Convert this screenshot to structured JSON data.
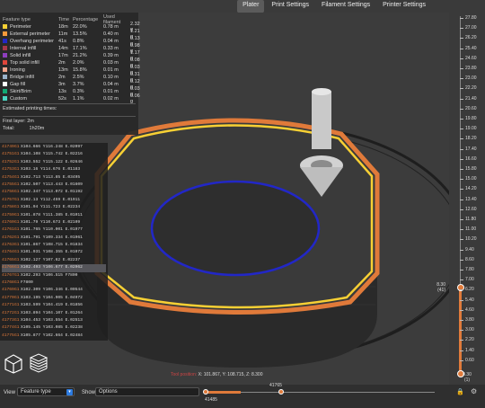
{
  "tabs": [
    {
      "label": "Plater",
      "active": true
    },
    {
      "label": "Print Settings",
      "active": false
    },
    {
      "label": "Filament Settings",
      "active": false
    },
    {
      "label": "Printer Settings",
      "active": false
    }
  ],
  "legend": {
    "headers": {
      "type": "Feature type",
      "time": "Time",
      "pct": "Percentage",
      "used": "Used filament"
    },
    "rows": [
      {
        "color": "#f7d034",
        "name": "Perimeter",
        "time": "18m",
        "pct": "22.0%",
        "m": "0.78 m",
        "g": "2.32 g"
      },
      {
        "color": "#f59b3b",
        "name": "External perimeter",
        "time": "11m",
        "pct": "13.5%",
        "m": "0.40 m",
        "g": "1.21 g"
      },
      {
        "color": "#2227c7",
        "name": "Overhang perimeter",
        "time": "41s",
        "pct": "0.8%",
        "m": "0.04 m",
        "g": "0.13 g"
      },
      {
        "color": "#a5384a",
        "name": "Internal infill",
        "time": "14m",
        "pct": "17.1%",
        "m": "0.33 m",
        "g": "0.98 g"
      },
      {
        "color": "#8e3fbf",
        "name": "Solid infill",
        "time": "17m",
        "pct": "21.2%",
        "m": "0.39 m",
        "g": "1.17 g"
      },
      {
        "color": "#e0463a",
        "name": "Top solid infill",
        "time": "2m",
        "pct": "2.0%",
        "m": "0.03 m",
        "g": "0.08 g"
      },
      {
        "color": "#f2a58c",
        "name": "Ironing",
        "time": "13m",
        "pct": "15.8%",
        "m": "0.01 m",
        "g": "0.03 g"
      },
      {
        "color": "#9ab2c9",
        "name": "Bridge infill",
        "time": "2m",
        "pct": "2.5%",
        "m": "0.10 m",
        "g": "0.31 g"
      },
      {
        "color": "#ffffff",
        "name": "Gap fill",
        "time": "3m",
        "pct": "3.7%",
        "m": "0.04 m",
        "g": "0.12 g"
      },
      {
        "color": "#11a873",
        "name": "Skirt/Brim",
        "time": "13s",
        "pct": "0.3%",
        "m": "0.01 m",
        "g": "0.03 g"
      },
      {
        "color": "#4bd6c2",
        "name": "Custom",
        "time": "52s",
        "pct": "1.1%",
        "m": "0.02 m",
        "g": "0.06 g"
      }
    ],
    "estimated_label": "Estimated printing times:",
    "first_layer_label": "First layer:",
    "first_layer_value": "2m",
    "total_label": "Total:",
    "total_value": "1h20m"
  },
  "gcode": [
    {
      "ln": "41749",
      "op": "G1",
      "text": "X104.666 Y116.248 E.02097"
    },
    {
      "ln": "41751",
      "op": "G1",
      "text": "X104.108 Y115.742 E.02216"
    },
    {
      "ln": "41752",
      "op": "G1",
      "text": "X103.552 Y115.122 E.02646"
    },
    {
      "ln": "41753",
      "op": "G1",
      "text": "X103.16 Y114.676 E.01183"
    },
    {
      "ln": "41754",
      "op": "G1",
      "text": "X102.713 Y113.85 E.03495"
    },
    {
      "ln": "41755",
      "op": "G1",
      "text": "X102.507 Y113.443 E.01609"
    },
    {
      "ln": "41756",
      "op": "G1",
      "text": "X102.347 Y113.072 E.01192"
    },
    {
      "ln": "41757",
      "op": "G1",
      "text": "X102.13 Y112.459 E.01911"
    },
    {
      "ln": "41758",
      "op": "G1",
      "text": "X101.94 Y111.723 E.02234"
    },
    {
      "ln": "41759",
      "op": "G1",
      "text": "X101.878 Y111.385 E.01011"
    },
    {
      "ln": "41760",
      "op": "G1",
      "text": "X101.79 Y110.673 E.02109"
    },
    {
      "ln": "41761",
      "op": "G1",
      "text": "X101.765 Y110.001 E.01977"
    },
    {
      "ln": "41762",
      "op": "G1",
      "text": "X101.791 Y109.334 E.01961"
    },
    {
      "ln": "41763",
      "op": "G1",
      "text": "X101.867 Y108.715 E.01834"
    },
    {
      "ln": "41764",
      "op": "G1",
      "text": "X101.931 Y108.355 E.01072"
    },
    {
      "ln": "41765",
      "op": "G1",
      "text": "X102.127 Y107.62 E.02237"
    },
    {
      "ln": "41766",
      "op": "G1",
      "text": "X102.493 Y106.677 E.02962"
    },
    {
      "ln": "41767",
      "op": "G1",
      "text": "X102.293 Y106.515 F7800"
    },
    {
      "ln": "41768",
      "op": "G1",
      "text": "F7800"
    },
    {
      "ln": "41769",
      "op": "G1",
      "text": "X102.309 Y106.346 E.00544"
    },
    {
      "ln": "41770",
      "op": "G1",
      "text": "X103.195 Y104.905 E.04972"
    },
    {
      "ln": "41771",
      "op": "G1",
      "text": "X103.599 Y104.419 E.01856"
    },
    {
      "ln": "41772",
      "op": "G1",
      "text": "X103.894 Y104.107 E.01264"
    },
    {
      "ln": "41773",
      "op": "G1",
      "text": "X104.453 Y103.554 E.02513"
    },
    {
      "ln": "41774",
      "op": "G1",
      "text": "X105.145 Y103.085 E.02238"
    },
    {
      "ln": "41775",
      "op": "G1",
      "text": "X105.877 Y102.664 E.02484"
    }
  ],
  "current_gcode_index": 16,
  "vruler": {
    "ticks": [
      "27.80",
      "27.00",
      "26.20",
      "25.40",
      "24.60",
      "23.80",
      "23.00",
      "22.20",
      "21.40",
      "20.60",
      "19.80",
      "19.00",
      "18.20",
      "17.40",
      "16.60",
      "15.80",
      "15.00",
      "14.20",
      "13.40",
      "12.60",
      "11.80",
      "11.00",
      "10.20",
      "9.40",
      "8.60",
      "7.80",
      "7.00",
      "6.20",
      "5.40",
      "4.60",
      "3.80",
      "3.00",
      "2.20",
      "1.40",
      "0.60"
    ],
    "current_height": "8.30",
    "current_layer": "(41)",
    "bottom_height": "0.30",
    "bottom_layer": "(1)",
    "accent": "#e07a3a"
  },
  "bottombar": {
    "view_label": "View",
    "view_value": "Feature type",
    "show_label": "Show",
    "show_value": "Options",
    "h_top_value": "41765",
    "h_bottom_value": "41485"
  },
  "tool_position": {
    "label": "Tool position:",
    "value": "X: 101.867, Y: 108.715, Z: 8.300"
  }
}
